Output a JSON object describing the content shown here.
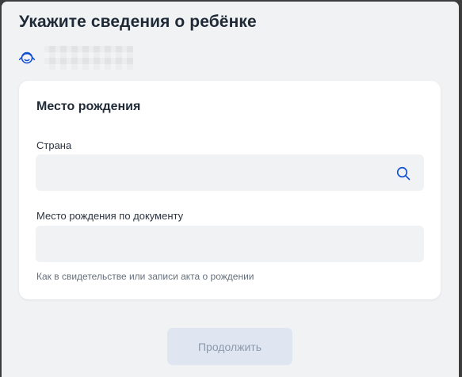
{
  "page": {
    "title": "Укажите сведения о ребёнке"
  },
  "child": {
    "icon": "child-avatar-icon",
    "name": ""
  },
  "birthplace": {
    "section_title": "Место рождения",
    "country": {
      "label": "Страна",
      "value": "",
      "placeholder": "",
      "icon": "search-icon"
    },
    "place_by_document": {
      "label": "Место рождения по документу",
      "value": "",
      "placeholder": "",
      "hint": "Как в свидетельстве или записи акта о рождении"
    }
  },
  "actions": {
    "continue_label": "Продолжить",
    "continue_enabled": false
  },
  "colors": {
    "accent": "#0d4cd3",
    "text": "#1f2a36",
    "input_background": "#f1f2f4",
    "page_background": "#f1f2f4",
    "disabled_button_background": "#dfe6f1",
    "disabled_button_text": "#8b99ad"
  }
}
